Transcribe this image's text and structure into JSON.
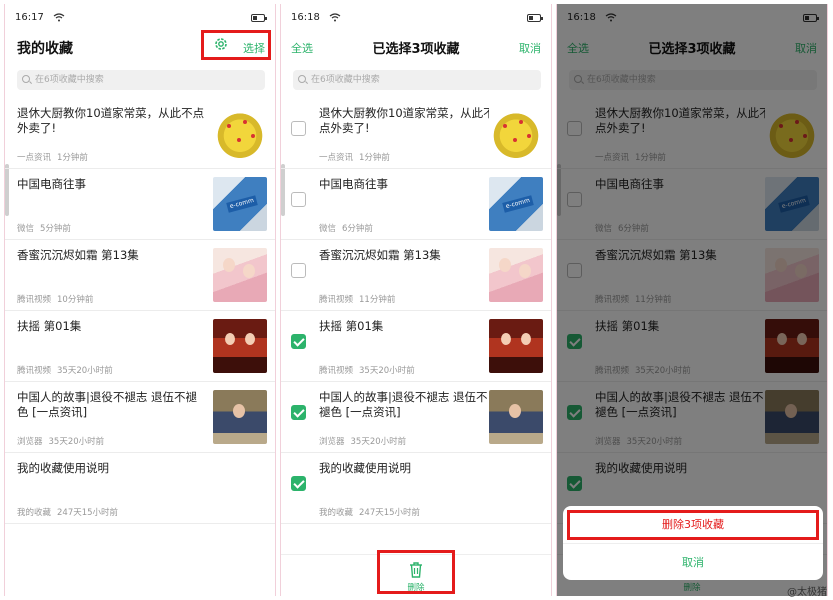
{
  "status": {
    "time_1": "16:17",
    "time_2": "16:18",
    "time_3": "16:18"
  },
  "screen1": {
    "title": "我的收藏",
    "select_label": "选择",
    "icon": "gear-icon"
  },
  "selection": {
    "select_all": "全选",
    "title": "已选择3项收藏",
    "cancel": "取消",
    "delete_label": "删除",
    "trash_icon": "trash-icon"
  },
  "search": {
    "placeholder": "在6项收藏中搜索"
  },
  "items": [
    {
      "title": "退休大厨教你10道家常菜，从此不点外卖了!",
      "source": "一点资讯",
      "time_1": "1分钟前",
      "time_2": "1分钟前",
      "checked": false,
      "thumb": "food"
    },
    {
      "title": "中国电商往事",
      "source": "微信",
      "time_1": "5分钟前",
      "time_2": "6分钟前",
      "checked": false,
      "thumb": "keyboard"
    },
    {
      "title": "香蜜沉沉烬如霜 第13集",
      "source": "腾讯视频",
      "time_1": "10分钟前",
      "time_2": "11分钟前",
      "checked": false,
      "thumb": "drama1"
    },
    {
      "title": "扶摇 第01集",
      "source": "腾讯视频",
      "time_1": "35天20小时前",
      "time_2": "35天20小时前",
      "checked": true,
      "thumb": "drama2"
    },
    {
      "title": "中国人的故事|退役不褪志 退伍不褪色 [一点资讯]",
      "source": "浏览器",
      "time_1": "35天20小时前",
      "time_2": "35天20小时前",
      "checked": true,
      "thumb": "office"
    },
    {
      "title": "我的收藏使用说明",
      "source": "我的收藏",
      "time_1": "247天15小时前",
      "time_2": "247天15小时前",
      "checked": true,
      "thumb": ""
    }
  ],
  "sheet": {
    "delete_confirm": "删除3项收藏",
    "cancel": "取消"
  },
  "thumb_keyboard_text": "e-comm",
  "watermark": "@太极猪",
  "colors": {
    "accent": "#2cb36b",
    "highlight": "#e41b1b",
    "danger": "#e41b1b"
  }
}
